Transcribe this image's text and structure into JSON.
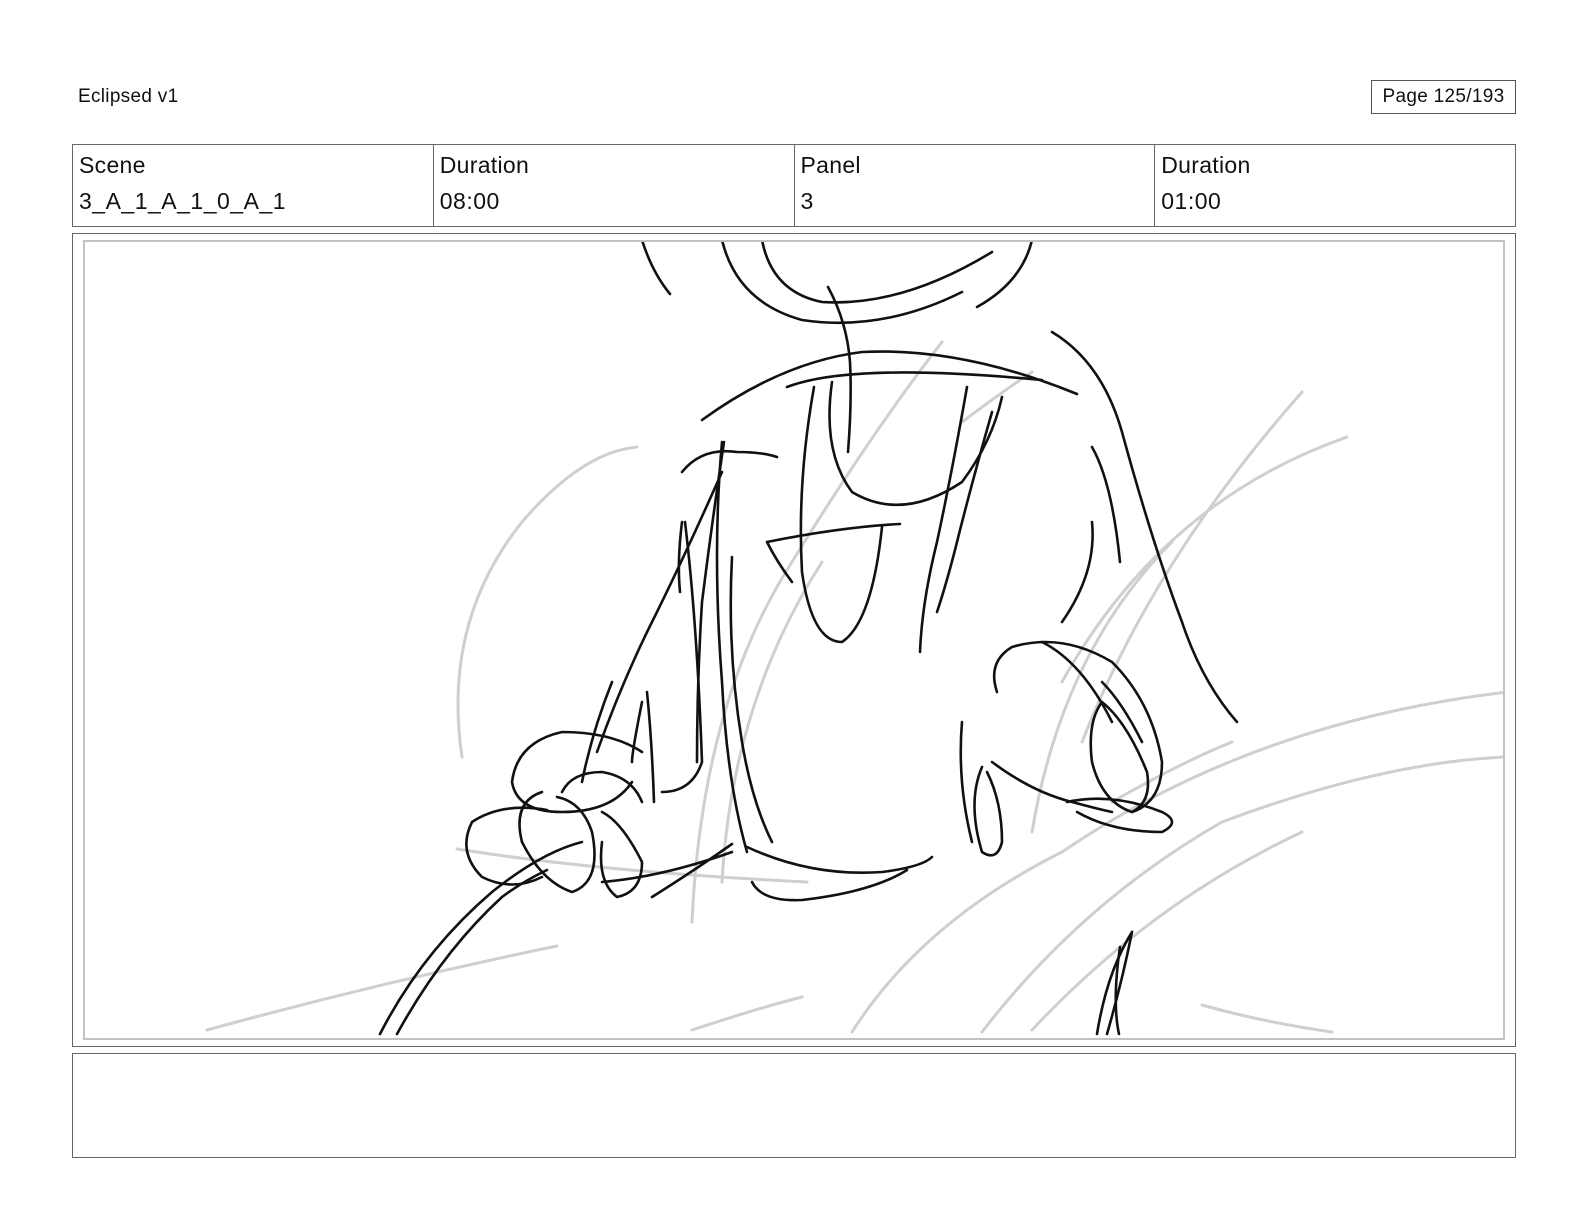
{
  "header": {
    "project_title": "Eclipsed v1",
    "page_indicator": "Page 125/193"
  },
  "info_bar": {
    "scene_label": "Scene",
    "scene_value": "3_A_1_A_1_0_A_1",
    "scene_duration_label": "Duration",
    "scene_duration_value": "08:00",
    "panel_label": "Panel",
    "panel_value": "3",
    "panel_duration_label": "Duration",
    "panel_duration_value": "01:00"
  },
  "notes": {
    "text": ""
  },
  "colors": {
    "sketch_line": "#111111",
    "rough_line": "#cfcfcf",
    "border": "#666666"
  }
}
